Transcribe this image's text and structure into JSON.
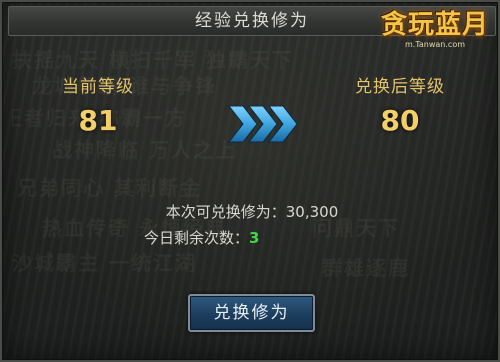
{
  "dialog": {
    "title": "经验兑换修为",
    "logo": {
      "name": "贪玩蓝月",
      "site": "m.Tanwan.com"
    },
    "current_level": {
      "label": "当前等级",
      "value": "81"
    },
    "target_level": {
      "label": "兑换后等级",
      "value": "80"
    },
    "exchange_info": {
      "label": "本次可兑换修为：",
      "value": "30,300"
    },
    "remaining": {
      "label": "今日剩余次数：",
      "value": "3"
    },
    "button_label": "兑换修为"
  },
  "colors": {
    "gold": "#f3cf68",
    "green": "#3fd64a",
    "arrow_blue": "#3fa6e0",
    "button_blue": "#1d3e5e"
  }
}
